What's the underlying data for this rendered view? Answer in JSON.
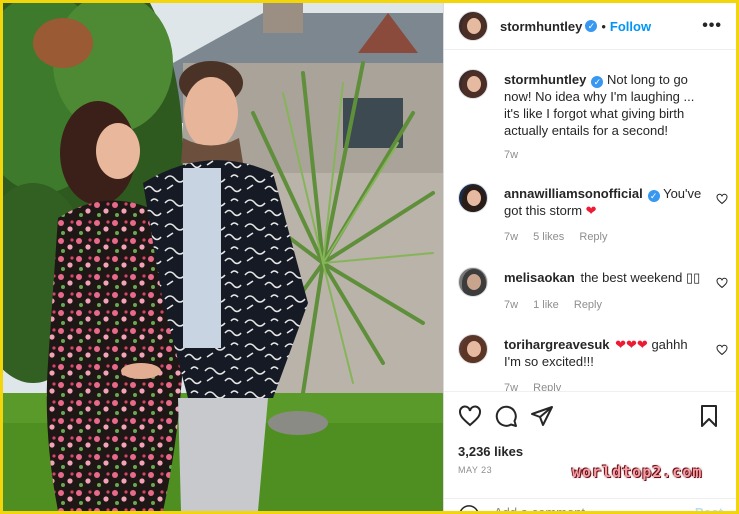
{
  "post": {
    "username": "stormhuntley",
    "follow_label": "Follow",
    "dot": "•",
    "more_label": "•••",
    "caption": {
      "username": "stormhuntley",
      "text": "Not long to go now! No idea why I'm laughing ... it's like I forgot what giving birth actually entails for a second!",
      "time": "7w"
    },
    "comments": [
      {
        "username": "annawilliamsonofficial",
        "verified": true,
        "text": "You've got this storm",
        "emoji": "❤",
        "time": "7w",
        "likes": "5 likes",
        "reply": "Reply"
      },
      {
        "username": "melisaokan",
        "verified": false,
        "text": "the best weekend ▯▯",
        "time": "7w",
        "likes": "1 like",
        "reply": "Reply"
      },
      {
        "username": "torihargreavesuk",
        "verified": false,
        "emoji": "❤❤❤",
        "text": "gahhh I'm so excited!!!",
        "time": "7w",
        "reply": "Reply"
      }
    ],
    "likes": "3,236 likes",
    "date": "MAY 23",
    "add_comment_placeholder": "Add a comment...",
    "post_label": "Post",
    "watermark": "worldtop2.com"
  },
  "colors": {
    "border": "#f2d60b",
    "follow": "#0095f6",
    "verified": "#3897f0",
    "heart": "#ed1b34"
  }
}
